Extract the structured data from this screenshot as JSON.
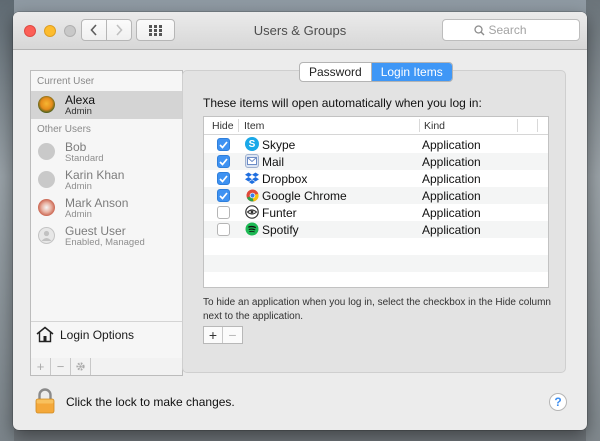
{
  "window": {
    "title": "Users & Groups",
    "search_placeholder": "Search"
  },
  "sidebar": {
    "current_user_header": "Current User",
    "current_user": {
      "name": "Alexa",
      "role": "Admin"
    },
    "other_users_header": "Other Users",
    "other_users": [
      {
        "name": "Bob",
        "role": "Standard"
      },
      {
        "name": "Karin Khan",
        "role": "Admin"
      },
      {
        "name": "Mark Anson",
        "role": "Admin"
      },
      {
        "name": "Guest User",
        "role": "Enabled, Managed"
      }
    ],
    "login_options_label": "Login Options",
    "tools": {
      "add": "+",
      "remove": "−"
    }
  },
  "tabs": {
    "password": "Password",
    "login_items": "Login Items",
    "active": "Login Items"
  },
  "login_items": {
    "heading": "These items will open automatically when you log in:",
    "columns": {
      "hide": "Hide",
      "item": "Item",
      "kind": "Kind"
    },
    "rows": [
      {
        "hide": true,
        "item": "Skype",
        "kind": "Application",
        "icon": "skype-icon",
        "color": "#1aa8e8"
      },
      {
        "hide": true,
        "item": "Mail",
        "kind": "Application",
        "icon": "mail-icon",
        "color": "#6c8cc6"
      },
      {
        "hide": true,
        "item": "Dropbox",
        "kind": "Application",
        "icon": "dropbox-icon",
        "color": "#1f6fe0"
      },
      {
        "hide": true,
        "item": "Google Chrome",
        "kind": "Application",
        "icon": "chrome-icon",
        "color": "#e04a3a"
      },
      {
        "hide": false,
        "item": "Funter",
        "kind": "Application",
        "icon": "funter-icon",
        "color": "#333333"
      },
      {
        "hide": false,
        "item": "Spotify",
        "kind": "Application",
        "icon": "spotify-icon",
        "color": "#1db954"
      }
    ],
    "hint": "To hide an application when you log in, select the checkbox in the Hide column next to the application.",
    "add": "+",
    "remove": "−"
  },
  "footer": {
    "lock_text": "Click the lock to make changes.",
    "help": "?"
  },
  "colors": {
    "accent": "#3f97f6",
    "selection": "#d4d4d4"
  }
}
